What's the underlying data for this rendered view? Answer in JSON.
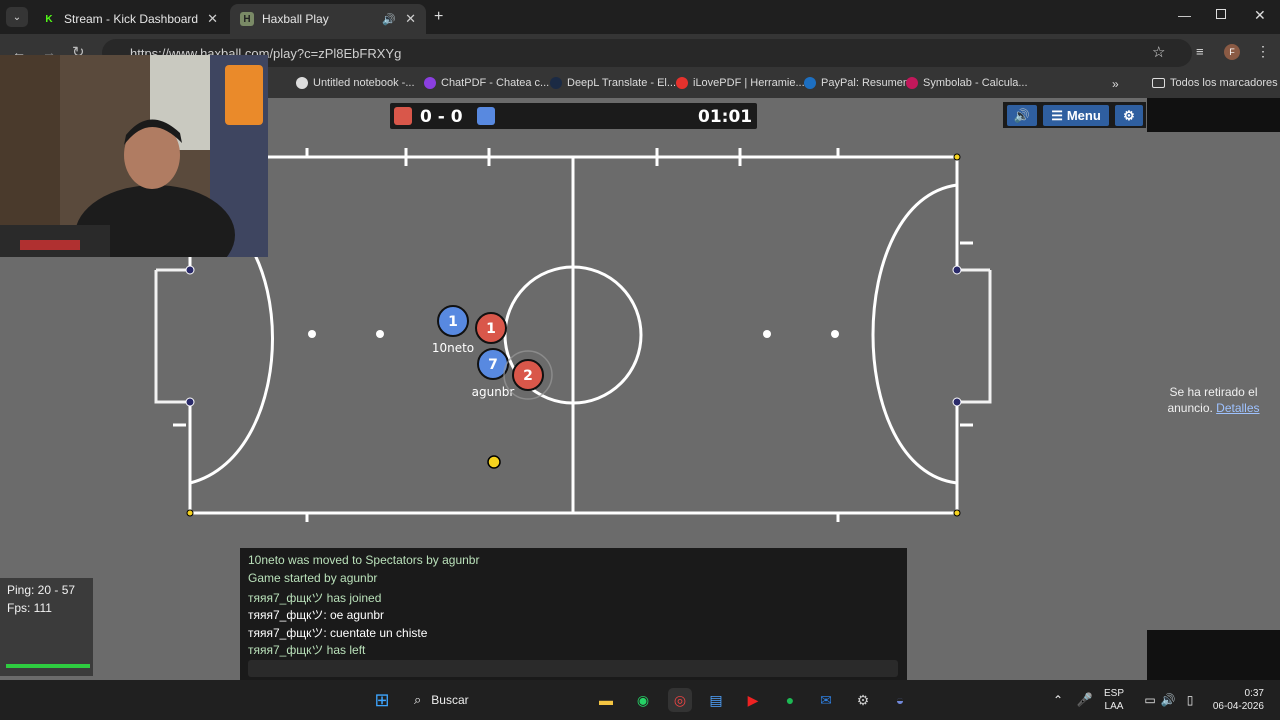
{
  "browser": {
    "tabs": [
      {
        "title": "Stream - Kick Dashboard",
        "active": false
      },
      {
        "title": "Haxball Play",
        "active": true
      }
    ],
    "url": "https://www.haxball.com/play?c=zPl8EbFRXYg",
    "profile_initial": "F",
    "bookmarks": [
      "Untitled notebook -...",
      "ChatPDF - Chatea c...",
      "DeepL Translate - El...",
      "iLovePDF | Herramie...",
      "PayPal: Resumen",
      "Symbolab - Calcula..."
    ],
    "all_bookmarks": "Todos los marcadores"
  },
  "game": {
    "score": "0 - 0",
    "timer": "01:01",
    "menu_label": "Menu",
    "players": [
      {
        "team": "blue",
        "number": "1",
        "name": "10neto"
      },
      {
        "team": "red",
        "number": "1",
        "name": ""
      },
      {
        "team": "blue",
        "number": "7",
        "name": "agunbr"
      },
      {
        "team": "red",
        "number": "2",
        "name": ""
      }
    ],
    "colors": {
      "red": "#d9574a",
      "blue": "#5889e0",
      "ball": "#f5d21e",
      "field": "#6b6b6b",
      "lines": "#ffffff"
    }
  },
  "ad": {
    "text": "Se ha retirado el anuncio.",
    "link": "Detalles"
  },
  "chat": {
    "messages": [
      {
        "text": "10neto was moved to Spectators by agunbr",
        "kind": "notice"
      },
      {
        "text": "Game started by agunbr",
        "kind": "notice"
      },
      {
        "text": "тяяя7_фщкツ has joined",
        "kind": "notice"
      },
      {
        "text": "тяяя7_фщкツ: oe agunbr",
        "kind": "user"
      },
      {
        "text": "тяяя7_фщкツ: cuentate un chiste",
        "kind": "user"
      },
      {
        "text": "тяяя7_фщкツ has left",
        "kind": "notice"
      }
    ]
  },
  "stats": {
    "ping": "Ping: 20 - 57",
    "fps": "Fps: 111"
  },
  "taskbar": {
    "search": "Buscar",
    "lang_top": "ESP",
    "lang_bottom": "LAA",
    "time": "0:37",
    "date": "06-04-2026"
  }
}
